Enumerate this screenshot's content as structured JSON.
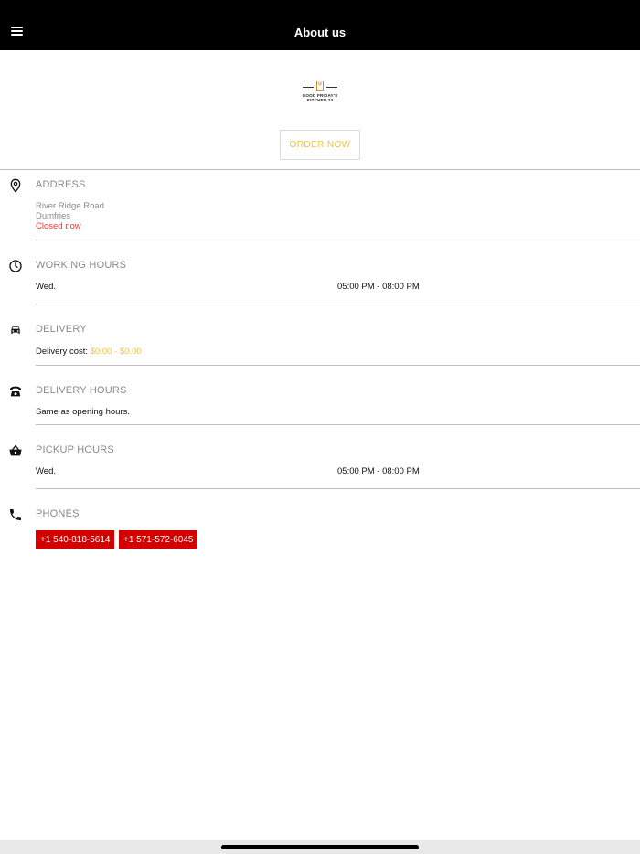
{
  "header": {
    "title": "About us"
  },
  "logo": {
    "line1": "GOOD FRIDAY'S",
    "line2": "KITCHEN 23"
  },
  "order_button": {
    "label": "ORDER NOW"
  },
  "address": {
    "title": "ADDRESS",
    "line1": "River Ridge Road",
    "line2": "Dumfries",
    "status": "Closed now"
  },
  "working_hours": {
    "title": "WORKING HOURS",
    "rows": [
      {
        "day": "Wed.",
        "hours": "05:00 PM - 08:00 PM"
      }
    ]
  },
  "delivery": {
    "title": "DELIVERY",
    "cost_label": "Delivery cost:",
    "cost_value": "$0.00 - $0.00"
  },
  "delivery_hours": {
    "title": "DELIVERY HOURS",
    "text": "Same as opening hours."
  },
  "pickup_hours": {
    "title": "PICKUP HOURS",
    "rows": [
      {
        "day": "Wed.",
        "hours": "05:00 PM - 08:00 PM"
      }
    ]
  },
  "phones": {
    "title": "PHONES",
    "numbers": [
      "+1 540-818-5614",
      "+1 571-572-6045"
    ]
  },
  "colors": {
    "header_bg": "#000000",
    "accent_yellow": "#f0c23a",
    "phone_chip": "#d40000",
    "closed_red": "#e53935"
  }
}
